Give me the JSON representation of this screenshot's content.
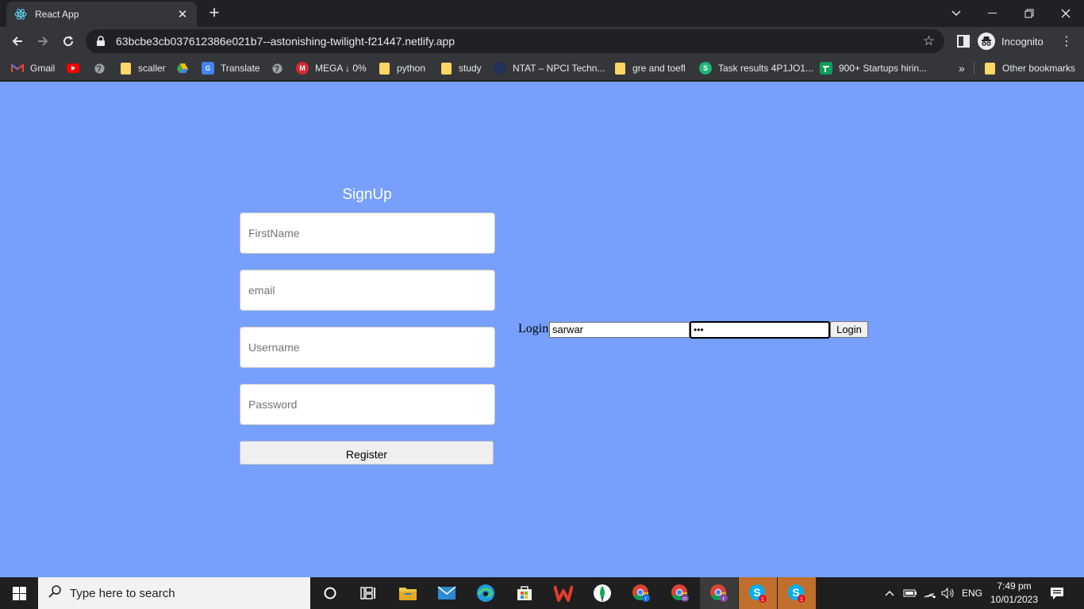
{
  "browser": {
    "tab_title": "React App",
    "tab_close": "✕",
    "new_tab": "+",
    "url": "63bcbe3cb037612386e021b7--astonishing-twilight-f21447.netlify.app",
    "profile_label": "Incognito"
  },
  "bookmarks": [
    {
      "label": "Gmail",
      "icon": "gmail-icon"
    },
    {
      "label": "",
      "icon": "youtube-icon"
    },
    {
      "label": "",
      "icon": "globe-icon"
    },
    {
      "label": "scaller",
      "icon": "folder-icon"
    },
    {
      "label": "",
      "icon": "google-drive-icon"
    },
    {
      "label": "Translate",
      "icon": "translate-icon"
    },
    {
      "label": "",
      "icon": "globe-icon"
    },
    {
      "label": "MEGA ↓ 0%",
      "icon": "mega-icon"
    },
    {
      "label": "python",
      "icon": "folder-icon"
    },
    {
      "label": "study",
      "icon": "folder-icon"
    },
    {
      "label": "NTAT – NPCI Techn...",
      "icon": "npci-icon"
    },
    {
      "label": "gre and toefl",
      "icon": "folder-icon"
    },
    {
      "label": "Task results 4P1JO1...",
      "icon": "task-icon"
    },
    {
      "label": "900+ Startups hirin...",
      "icon": "sheets-icon"
    }
  ],
  "bookmarks_overflow": "»",
  "other_bookmarks": "Other bookmarks",
  "signup": {
    "title": "SignUp",
    "firstname_placeholder": "FirstName",
    "email_placeholder": "email",
    "username_placeholder": "Username",
    "password_placeholder": "Password",
    "register_label": "Register"
  },
  "login": {
    "label": "Login",
    "username_value": "sarwar",
    "password_value": "•••",
    "button_label": "Login"
  },
  "taskbar": {
    "search_placeholder": "Type here to search",
    "language": "ENG",
    "time": "7:49 pm",
    "date": "10/01/2023",
    "skype_badge_1": "1",
    "skype_badge_2": "1"
  }
}
